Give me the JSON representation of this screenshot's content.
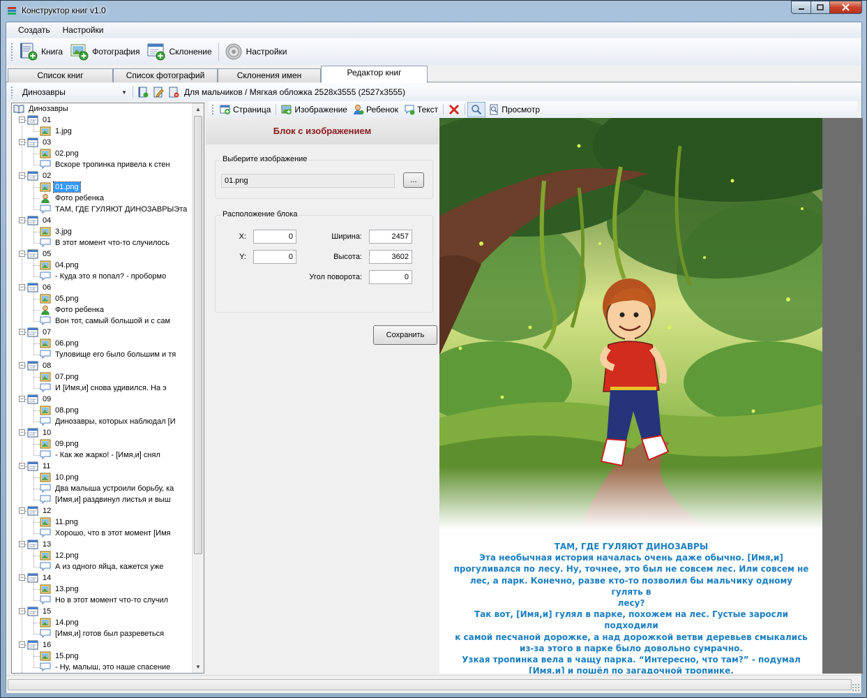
{
  "window": {
    "title": "Конструктор книг v1.0"
  },
  "menu": [
    "Создать",
    "Настройки"
  ],
  "toolbar": {
    "book_label": "Книга",
    "photo_label": "Фотография",
    "declension_label": "Склонение",
    "settings_label": "Настройки"
  },
  "tabs": [
    "Список книг",
    "Список фотографий",
    "Склонения имен",
    "Редактор книг"
  ],
  "bookbar": {
    "selected_book": "Динозавры",
    "info": "Для мальчиков / Мягкая обложка 2528x3555 (2527x3555)"
  },
  "tree": {
    "root": "Динозавры",
    "items": [
      {
        "level": 1,
        "type": "page",
        "label": "01"
      },
      {
        "level": 2,
        "type": "image",
        "label": "1.jpg"
      },
      {
        "level": 1,
        "type": "page",
        "label": "03"
      },
      {
        "level": 2,
        "type": "image",
        "label": "02.png"
      },
      {
        "level": 2,
        "type": "text",
        "label": "Вскоре тропинка привела к стен"
      },
      {
        "level": 1,
        "type": "page",
        "label": "02"
      },
      {
        "level": 2,
        "type": "image",
        "label": "01.png",
        "selected": true
      },
      {
        "level": 2,
        "type": "child",
        "label": "Фото ребенка"
      },
      {
        "level": 2,
        "type": "text",
        "label": "ТАМ, ГДЕ ГУЛЯЮТ ДИНОЗАВРЫЭта"
      },
      {
        "level": 1,
        "type": "page",
        "label": "04"
      },
      {
        "level": 2,
        "type": "image",
        "label": "3.jpg"
      },
      {
        "level": 2,
        "type": "text",
        "label": "В этот момент что-то случилось"
      },
      {
        "level": 1,
        "type": "page",
        "label": "05"
      },
      {
        "level": 2,
        "type": "image",
        "label": "04.png"
      },
      {
        "level": 2,
        "type": "text",
        "label": "- Куда это я попал? - пробормо"
      },
      {
        "level": 1,
        "type": "page",
        "label": "06"
      },
      {
        "level": 2,
        "type": "image",
        "label": "05.png"
      },
      {
        "level": 2,
        "type": "child",
        "label": "Фото ребенка"
      },
      {
        "level": 2,
        "type": "text",
        "label": "Вон тот, самый большой и с сам"
      },
      {
        "level": 1,
        "type": "page",
        "label": "07"
      },
      {
        "level": 2,
        "type": "image",
        "label": "06.png"
      },
      {
        "level": 2,
        "type": "text",
        "label": "Туловище его было большим и тя"
      },
      {
        "level": 1,
        "type": "page",
        "label": "08"
      },
      {
        "level": 2,
        "type": "image",
        "label": "07.png"
      },
      {
        "level": 2,
        "type": "text",
        "label": "И [Имя,и] снова удивился. На э"
      },
      {
        "level": 1,
        "type": "page",
        "label": "09"
      },
      {
        "level": 2,
        "type": "image",
        "label": "08.png"
      },
      {
        "level": 2,
        "type": "text",
        "label": "Динозавры, которых наблюдал [И"
      },
      {
        "level": 1,
        "type": "page",
        "label": "10"
      },
      {
        "level": 2,
        "type": "image",
        "label": "09.png"
      },
      {
        "level": 2,
        "type": "text",
        "label": "- Как же жарко! - [Имя,и] снял"
      },
      {
        "level": 1,
        "type": "page",
        "label": "11"
      },
      {
        "level": 2,
        "type": "image",
        "label": "10.png"
      },
      {
        "level": 2,
        "type": "text",
        "label": "Два малыша устроили борьбу, ка"
      },
      {
        "level": 2,
        "type": "text",
        "label": "[Имя,и] раздвинул листья и выш"
      },
      {
        "level": 1,
        "type": "page",
        "label": "12"
      },
      {
        "level": 2,
        "type": "image",
        "label": "11.png"
      },
      {
        "level": 2,
        "type": "text",
        "label": "Хорошо, что в этот момент [Имя"
      },
      {
        "level": 1,
        "type": "page",
        "label": "13"
      },
      {
        "level": 2,
        "type": "image",
        "label": "12.png"
      },
      {
        "level": 2,
        "type": "text",
        "label": "А из одного яйца, кажется уже"
      },
      {
        "level": 1,
        "type": "page",
        "label": "14"
      },
      {
        "level": 2,
        "type": "image",
        "label": "13.png"
      },
      {
        "level": 2,
        "type": "text",
        "label": "Но в этот момент что-то случил"
      },
      {
        "level": 1,
        "type": "page",
        "label": "15"
      },
      {
        "level": 2,
        "type": "image",
        "label": "14.png"
      },
      {
        "level": 2,
        "type": "text",
        "label": "[Имя,и] готов был разреветься"
      },
      {
        "level": 1,
        "type": "page",
        "label": "16"
      },
      {
        "level": 2,
        "type": "image",
        "label": "15.png"
      },
      {
        "level": 2,
        "type": "text",
        "label": "- Ну, малыш, это наше спасение"
      }
    ]
  },
  "pagebar": {
    "page_label": "Страница",
    "image_label": "Изображение",
    "child_label": "Ребенок",
    "text_label": "Текст",
    "preview_label": "Просмотр"
  },
  "block": {
    "header": "Блок с изображением",
    "image_group": "Выберите изображение",
    "image_value": "01.png",
    "browse_label": "...",
    "position_group": "Расположение блока",
    "x_label": "X:",
    "x_value": "0",
    "y_label": "Y:",
    "y_value": "0",
    "width_label": "Ширина:",
    "width_value": "2457",
    "height_label": "Высота:",
    "height_value": "3602",
    "rotation_label": "Угол поворота:",
    "rotation_value": "0",
    "save_label": "Сохранить"
  },
  "preview": {
    "story_title": "ТАМ, ГДЕ ГУЛЯЮТ ДИНОЗАВРЫ",
    "story_lines": [
      "Эта необычная история началась очень даже обычно. [Имя,и]",
      "прогуливался по лесу. Ну, точнее, это был не совсем лес. Или совсем не",
      "лес, а парк. Конечно, разве кто-то позволил бы мальчику одному гулять в",
      "лесу?",
      "Так вот, [Имя,и] гулял в парке, похожем на лес. Густые заросли подходили",
      "к самой песчаной дорожке, а над дорожкой ветви деревьев смыкались",
      "из-за этого в парке было довольно сумрачно.",
      "Узкая тропинка вела в чащу парка. “Интересно, что там?” - подумал",
      "[Имя,и] и пошёл по загадочной тропинке."
    ]
  },
  "colors": {
    "story_text": "#1b7fc0",
    "block_header": "#8b1a1a",
    "selection": "#3399ff"
  }
}
